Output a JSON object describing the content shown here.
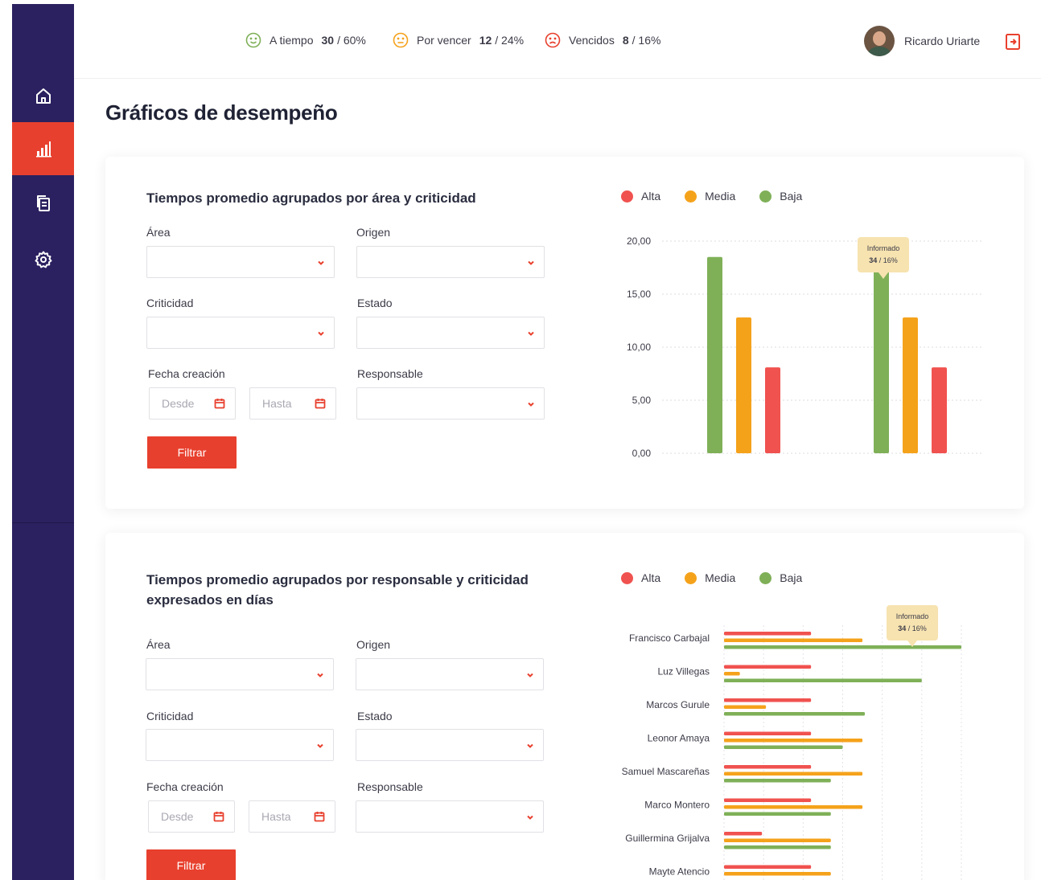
{
  "colors": {
    "alta": "#f0524f",
    "media": "#f5a21b",
    "baja": "#7fb058",
    "accent": "#e8402e",
    "sidebar": "#2b2160"
  },
  "sidebar": {
    "items": [
      {
        "icon": "home-icon"
      },
      {
        "icon": "bar-chart-icon",
        "active": true
      },
      {
        "icon": "documents-icon"
      },
      {
        "icon": "gear-icon"
      }
    ]
  },
  "header": {
    "stats": [
      {
        "label": "A tiempo",
        "count": "30",
        "pct": "/ 60%",
        "icon": "smile-face-icon",
        "color": "#7fb058"
      },
      {
        "label": "Por vencer",
        "count": "12",
        "pct": "/ 24%",
        "icon": "neutral-face-icon",
        "color": "#f5a21b"
      },
      {
        "label": "Vencidos",
        "count": "8",
        "pct": "/ 16%",
        "icon": "sad-face-icon",
        "color": "#e8402e"
      }
    ],
    "user_name": "Ricardo Uriarte"
  },
  "page_title": "Gráficos de desempeño",
  "filters": {
    "area": "Área",
    "origen": "Origen",
    "criticidad": "Criticidad",
    "estado": "Estado",
    "fecha": "Fecha creación",
    "responsable": "Responsable",
    "desde": "Desde",
    "hasta": "Hasta",
    "filtrar": "Filtrar"
  },
  "legend": {
    "alta": "Alta",
    "media": "Media",
    "baja": "Baja"
  },
  "card1": {
    "title": "Tiempos promedio agrupados por área y criticidad"
  },
  "card2": {
    "title": "Tiempos promedio agrupados por responsable y criticidad expresados en días"
  },
  "tooltip": {
    "title": "Informado",
    "value": "34",
    "pct": "/ 16%"
  },
  "chart_data": [
    {
      "type": "bar",
      "orientation": "vertical",
      "title": "Tiempos promedio agrupados por área y criticidad",
      "yticks": [
        "0,00",
        "5,00",
        "10,00",
        "15,00",
        "20,00"
      ],
      "ylim": [
        0,
        20
      ],
      "categories": [
        "",
        ""
      ],
      "series": [
        {
          "name": "Baja",
          "values": [
            18.5,
            18.5
          ]
        },
        {
          "name": "Media",
          "values": [
            12.8,
            12.8
          ]
        },
        {
          "name": "Alta",
          "values": [
            8.1,
            8.1
          ]
        }
      ],
      "legend": "top-left",
      "grid": true
    },
    {
      "type": "bar",
      "orientation": "horizontal",
      "title": "Tiempos promedio agrupados por responsable y criticidad expresados en días",
      "categories": [
        "Francisco Carbajal",
        "Luz Villegas",
        "Marcos Gurule",
        "Leonor Amaya",
        "Samuel Mascareñas",
        "Marco Montero",
        "Guillermina Grijalva",
        "Mayte Atencio"
      ],
      "series": [
        {
          "name": "Alta",
          "values": [
            11,
            11,
            11,
            11,
            11,
            11,
            4.8,
            11
          ]
        },
        {
          "name": "Media",
          "values": [
            17.5,
            2,
            5.3,
            17.5,
            17.5,
            17.5,
            13.5,
            13.5
          ]
        },
        {
          "name": "Baja",
          "values": [
            30,
            25,
            17.8,
            15,
            13.5,
            13.5,
            13.5,
            0
          ]
        }
      ],
      "xlim": [
        0,
        30
      ],
      "legend": "top-left",
      "grid": true
    }
  ]
}
